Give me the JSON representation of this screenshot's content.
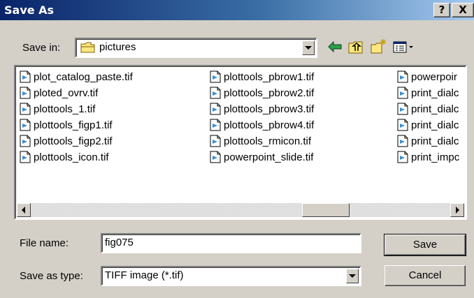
{
  "title": "Save As",
  "titlebar": {
    "help": "?",
    "close": "X"
  },
  "save_in": {
    "label": "Save in:",
    "value": "pictures"
  },
  "files": [
    [
      "plot_catalog_paste.tif",
      "ploted_ovrv.tif",
      "plottools_1.tif",
      "plottools_figp1.tif",
      "plottools_figp2.tif",
      "plottools_icon.tif"
    ],
    [
      "plottools_pbrow1.tif",
      "plottools_pbrow2.tif",
      "plottools_pbrow3.tif",
      "plottools_pbrow4.tif",
      "plottools_rmicon.tif",
      "powerpoint_slide.tif"
    ],
    [
      "powerpoir",
      "print_dialc",
      "print_dialc",
      "print_dialc",
      "print_dialc",
      "print_impc"
    ]
  ],
  "file_name": {
    "label": "File name:",
    "value": "fig075"
  },
  "save_as_type": {
    "label": "Save as type:",
    "value": "TIFF image (*.tif)"
  },
  "buttons": {
    "save": "Save",
    "cancel": "Cancel"
  },
  "icons": {
    "back": "back-arrow-icon",
    "up": "up-folder-icon",
    "new_folder": "new-folder-icon",
    "view": "view-menu-icon",
    "file": "tif-file-icon"
  }
}
